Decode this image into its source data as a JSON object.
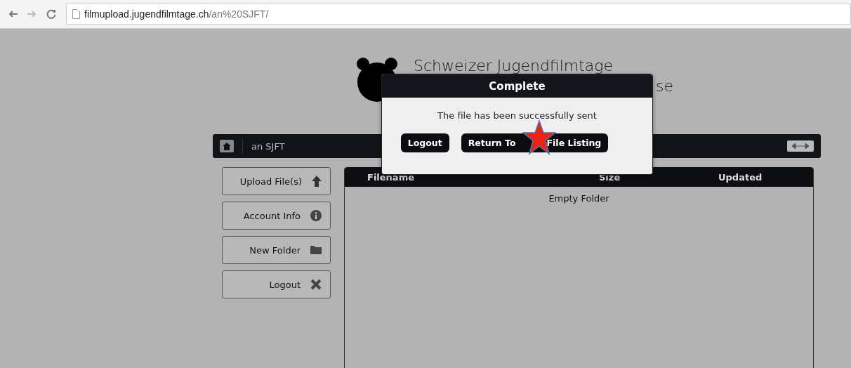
{
  "browser": {
    "url_host": "filmupload.jugendfilmtage.ch",
    "url_path": "/an%20SJFT/"
  },
  "header": {
    "title": "Schweizer Jugendfilmtage",
    "subtitle_visible": "se"
  },
  "toolbar": {
    "folder": "an SJFT"
  },
  "sidebar": {
    "buttons": [
      {
        "label": "Upload File(s)",
        "kind": "upload"
      },
      {
        "label": "Account Info",
        "kind": "info"
      },
      {
        "label": "New Folder",
        "kind": "folder"
      },
      {
        "label": "Logout",
        "kind": "logout"
      }
    ]
  },
  "table": {
    "columns": [
      "Filename",
      "Size",
      "Updated"
    ],
    "empty_text": "Empty Folder"
  },
  "dialog": {
    "title": "Complete",
    "message": "The file has been successfully sent",
    "buttons": [
      {
        "parts": [
          "Logout"
        ]
      },
      {
        "parts": [
          "Return To",
          "File Listing"
        ]
      }
    ]
  }
}
